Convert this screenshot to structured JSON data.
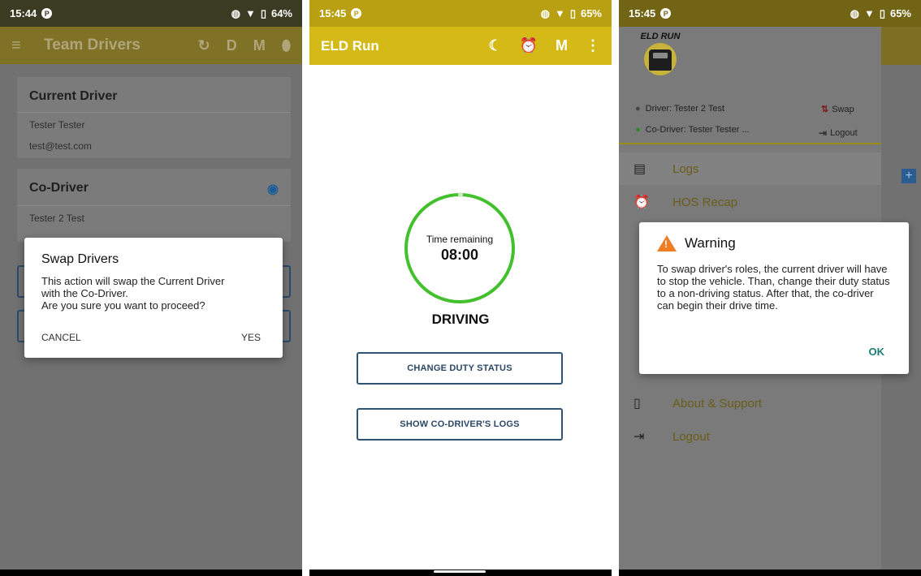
{
  "panel1": {
    "status": {
      "time": "15:44",
      "battery": "64%"
    },
    "appbar": {
      "title": "Team Drivers",
      "actions": [
        "D",
        "M"
      ]
    },
    "current_driver": {
      "title": "Current Driver",
      "name": "Tester Tester",
      "email": "test@test.com"
    },
    "co_driver": {
      "title": "Co-Driver",
      "name": "Tester 2 Test"
    },
    "dialog": {
      "title": "Swap Drivers",
      "body": "This action will swap the Current Driver\nwith the Co-Driver.\nAre you sure you want to proceed?",
      "cancel": "CANCEL",
      "confirm": "YES"
    }
  },
  "panel2": {
    "status": {
      "time": "15:45",
      "battery": "65%"
    },
    "appbar": {
      "title": "ELD Run",
      "action_m": "M"
    },
    "timer": {
      "label": "Time remaining",
      "value": "08:00"
    },
    "duty_status": "DRIVING",
    "buttons": {
      "change_status": "CHANGE DUTY STATUS",
      "show_co_logs": "SHOW CO-DRIVER'S LOGS"
    }
  },
  "panel3": {
    "status": {
      "time": "15:45",
      "battery": "65%"
    },
    "logo_text": "ELD RUN",
    "drawer": {
      "driver": "Driver: Tester 2 Test",
      "co_driver": "Co-Driver: Tester Tester ...",
      "swap": "Swap",
      "logout_small": "Logout",
      "items": [
        {
          "label": "Logs"
        },
        {
          "label": "HOS Recap"
        },
        {
          "label": "About & Support"
        },
        {
          "label": "Logout"
        }
      ]
    },
    "dialog": {
      "title": "Warning",
      "body": "To swap driver's roles, the current driver will have to stop the vehicle. Than, change their duty status to a non-driving status. After that, the co-driver can begin their drive time.",
      "ok": "OK"
    }
  },
  "colors": {
    "accent": "#d4b917",
    "driving_ring": "#43c02d",
    "warning": "#ef7d23",
    "ok_teal": "#1a7f73"
  }
}
